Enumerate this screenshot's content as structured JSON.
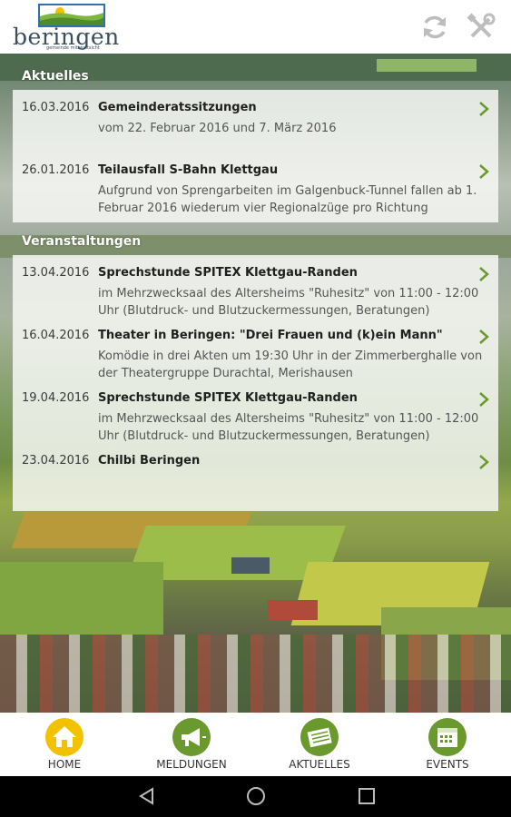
{
  "app": {
    "logo_name": "beringen",
    "logo_tagline": "gemeinde mit weitsicht"
  },
  "header": {
    "refresh_icon": "refresh-icon",
    "tools_icon": "tools-icon"
  },
  "aktuelles": {
    "title": "Aktuelles",
    "items": [
      {
        "date": "16.03.2016",
        "title": "Gemeinderatssitzungen",
        "desc": "vom 22. Februar 2016 und 7. März 2016"
      },
      {
        "date": "26.01.2016",
        "title": "Teilausfall S-Bahn Klettgau",
        "desc": "Aufgrund von Sprengarbeiten im Galgenbuck-Tunnel fallen ab 1. Februar 2016 wiederum vier Regionalzüge pro Richtung"
      }
    ]
  },
  "veranstaltungen": {
    "title": "Veranstaltungen",
    "items": [
      {
        "date": "13.04.2016",
        "title": "Sprechstunde SPITEX Klettgau-Randen",
        "desc": "im Mehrzwecksaal des Altersheims \"Ruhesitz\" von 11:00 - 12:00 Uhr (Blutdruck- und Blutzuckermessungen, Beratungen)"
      },
      {
        "date": "16.04.2016",
        "title": "Theater in Beringen: \"Drei Frauen und (k)ein Mann\"",
        "desc": "Komödie in drei Akten um 19:30 Uhr in der Zimmerberghalle von der Theatergruppe Durachtal, Merishausen"
      },
      {
        "date": "19.04.2016",
        "title": "Sprechstunde SPITEX Klettgau-Randen",
        "desc": "im Mehrzwecksaal des Altersheims \"Ruhesitz\" von 11:00 - 12:00 Uhr (Blutdruck- und Blutzuckermessungen, Beratungen)"
      },
      {
        "date": "23.04.2016",
        "title": "Chilbi Beringen",
        "desc": ""
      }
    ]
  },
  "nav": [
    {
      "label": "HOME",
      "icon": "home-icon",
      "color": "#f2c200"
    },
    {
      "label": "MELDUNGEN",
      "icon": "megaphone-icon",
      "color": "#6a9a2e"
    },
    {
      "label": "AKTUELLES",
      "icon": "newspaper-icon",
      "color": "#6a9a2e"
    },
    {
      "label": "EVENTS",
      "icon": "calendar-icon",
      "color": "#6a9a2e"
    }
  ],
  "colors": {
    "accent_green": "#6a9a2e",
    "home_yellow": "#f2c200"
  }
}
